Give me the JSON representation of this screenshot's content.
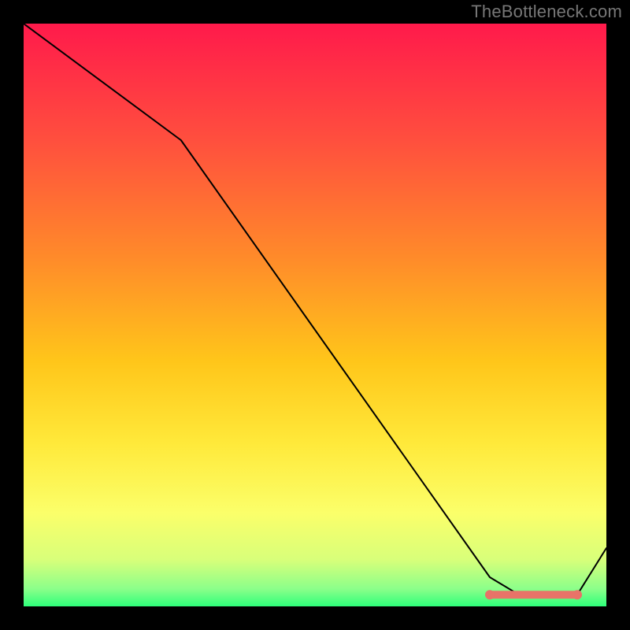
{
  "watermark": "TheBottleneck.com",
  "chart_data": {
    "type": "line",
    "title": "",
    "xlabel": "",
    "ylabel": "",
    "xlim": [
      0,
      100
    ],
    "ylim": [
      0,
      100
    ],
    "series": [
      {
        "name": "curve",
        "x": [
          0,
          27,
          80,
          85,
          90,
          95,
          100
        ],
        "values": [
          100,
          80,
          5,
          2,
          2,
          2,
          10
        ]
      }
    ],
    "highlight_range": {
      "x_start": 80,
      "x_end": 95,
      "y": 2
    },
    "gradient_stops": [
      {
        "offset": 0.0,
        "color": "#ff1a4b"
      },
      {
        "offset": 0.2,
        "color": "#ff4f3e"
      },
      {
        "offset": 0.4,
        "color": "#ff8a2a"
      },
      {
        "offset": 0.58,
        "color": "#ffc61a"
      },
      {
        "offset": 0.72,
        "color": "#ffe93a"
      },
      {
        "offset": 0.84,
        "color": "#fbff6a"
      },
      {
        "offset": 0.92,
        "color": "#d8ff7a"
      },
      {
        "offset": 0.97,
        "color": "#8bff8a"
      },
      {
        "offset": 1.0,
        "color": "#2eff7a"
      }
    ]
  }
}
